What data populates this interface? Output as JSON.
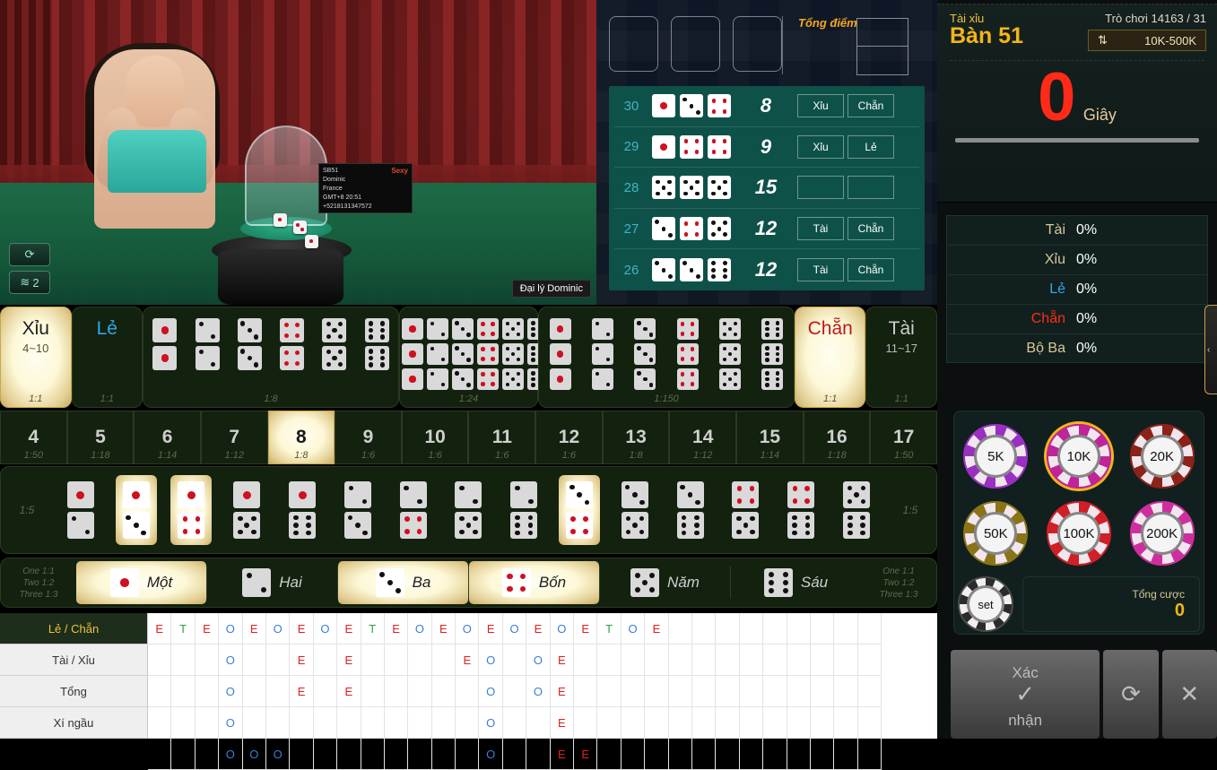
{
  "video": {
    "sign_lines": [
      "SB51",
      "Dominic",
      "France",
      "+5218131347572"
    ],
    "sign_meta": "GMT+8  20:51",
    "sign_logo": "Sexy",
    "dealer_tag": "Đại lý Dominic",
    "refresh_icon": "refresh-icon",
    "signal_icon": "wifi-icon",
    "signal_level": "2"
  },
  "history_panel": {
    "total_label": "Tổng điểm",
    "rows": [
      {
        "round": "30",
        "dice": [
          1,
          3,
          4
        ],
        "sum": "8",
        "tags": [
          "Xỉu",
          "Chẵn"
        ]
      },
      {
        "round": "29",
        "dice": [
          1,
          4,
          4
        ],
        "sum": "9",
        "tags": [
          "Xỉu",
          "Lẻ"
        ]
      },
      {
        "round": "28",
        "dice": [
          5,
          5,
          5
        ],
        "sum": "15",
        "tags": [
          "",
          ""
        ]
      },
      {
        "round": "27",
        "dice": [
          3,
          4,
          5
        ],
        "sum": "12",
        "tags": [
          "Tài",
          "Chẵn"
        ]
      },
      {
        "round": "26",
        "dice": [
          3,
          3,
          6
        ],
        "sum": "12",
        "tags": [
          "Tài",
          "Chẵn"
        ]
      }
    ]
  },
  "board": {
    "xiu": {
      "label": "Xỉu",
      "range": "4~10",
      "odds": "1:1",
      "selected": true
    },
    "le": {
      "label": "Lẻ",
      "odds": "1:1",
      "selected": false
    },
    "pairs": {
      "odds": "1:8",
      "values": [
        1,
        2,
        3,
        4,
        5,
        6
      ]
    },
    "triple_any": {
      "odds": "1:24",
      "values": [
        1,
        2,
        3,
        4,
        5,
        6
      ]
    },
    "triple_exact": {
      "odds": "1:150",
      "values": [
        1,
        2,
        3,
        4,
        5,
        6
      ]
    },
    "chan": {
      "label": "Chẵn",
      "odds": "1:1",
      "selected": true
    },
    "tai": {
      "label": "Tài",
      "range": "11~17",
      "odds": "1:1",
      "selected": false
    },
    "totals": [
      {
        "n": "4",
        "odds": "1:50",
        "selected": false
      },
      {
        "n": "5",
        "odds": "1:18",
        "selected": false
      },
      {
        "n": "6",
        "odds": "1:14",
        "selected": false
      },
      {
        "n": "7",
        "odds": "1:12",
        "selected": false
      },
      {
        "n": "8",
        "odds": "1:8",
        "selected": true
      },
      {
        "n": "9",
        "odds": "1:6",
        "selected": false
      },
      {
        "n": "10",
        "odds": "1:6",
        "selected": false
      },
      {
        "n": "11",
        "odds": "1:6",
        "selected": false
      },
      {
        "n": "12",
        "odds": "1:6",
        "selected": false
      },
      {
        "n": "13",
        "odds": "1:8",
        "selected": false
      },
      {
        "n": "14",
        "odds": "1:12",
        "selected": false
      },
      {
        "n": "15",
        "odds": "1:14",
        "selected": false
      },
      {
        "n": "16",
        "odds": "1:18",
        "selected": false
      },
      {
        "n": "17",
        "odds": "1:50",
        "selected": false
      }
    ],
    "combos": {
      "odds_left": "1:5",
      "odds_right": "1:5",
      "pairs": [
        {
          "a": 1,
          "b": 2,
          "selected": false
        },
        {
          "a": 1,
          "b": 3,
          "selected": true
        },
        {
          "a": 1,
          "b": 4,
          "selected": true
        },
        {
          "a": 1,
          "b": 5,
          "selected": false
        },
        {
          "a": 1,
          "b": 6,
          "selected": false
        },
        {
          "a": 2,
          "b": 3,
          "selected": false
        },
        {
          "a": 2,
          "b": 4,
          "selected": false
        },
        {
          "a": 2,
          "b": 5,
          "selected": false
        },
        {
          "a": 2,
          "b": 6,
          "selected": false
        },
        {
          "a": 3,
          "b": 4,
          "selected": true
        },
        {
          "a": 3,
          "b": 5,
          "selected": false
        },
        {
          "a": 3,
          "b": 6,
          "selected": false
        },
        {
          "a": 4,
          "b": 5,
          "selected": false
        },
        {
          "a": 4,
          "b": 6,
          "selected": false
        },
        {
          "a": 5,
          "b": 6,
          "selected": false
        }
      ]
    },
    "singles": {
      "odds_lines": [
        "One 1:1",
        "Two 1:2",
        "Three 1:3"
      ],
      "items": [
        {
          "face": 1,
          "label": "Một",
          "selected": true
        },
        {
          "face": 2,
          "label": "Hai",
          "selected": false
        },
        {
          "face": 3,
          "label": "Ba",
          "selected": true
        },
        {
          "face": 4,
          "label": "Bốn",
          "selected": true
        },
        {
          "face": 5,
          "label": "Năm",
          "selected": false
        },
        {
          "face": 6,
          "label": "Sáu",
          "selected": false
        }
      ]
    }
  },
  "roadmap": {
    "labels": [
      "Lẻ / Chẵn",
      "Tài / Xỉu",
      "Tổng",
      "Xí ngầu"
    ],
    "rows": [
      [
        "E",
        "T",
        "E",
        "O",
        "E",
        "O",
        "E",
        "O",
        "E",
        "T",
        "E",
        "O",
        "E",
        "O",
        "E",
        "O",
        "E",
        "O",
        "E",
        "T",
        "O",
        "E",
        "",
        "",
        "",
        "",
        "",
        "",
        "",
        "",
        ""
      ],
      [
        "",
        "",
        "",
        "O",
        "",
        "",
        "E",
        "",
        "E",
        "",
        "",
        "",
        "",
        "E",
        "O",
        "",
        "O",
        "E",
        "",
        "",
        "",
        "",
        "",
        "",
        "",
        "",
        "",
        "",
        "",
        "",
        ""
      ],
      [
        "",
        "",
        "",
        "O",
        "",
        "",
        "E",
        "",
        "E",
        "",
        "",
        "",
        "",
        "",
        "O",
        "",
        "O",
        "E",
        "",
        "",
        "",
        "",
        "",
        "",
        "",
        "",
        "",
        "",
        "",
        "",
        ""
      ],
      [
        "",
        "",
        "",
        "O",
        "",
        "",
        "",
        "",
        "",
        "",
        "",
        "",
        "",
        "",
        "O",
        "",
        "",
        "E",
        "",
        "",
        "",
        "",
        "",
        "",
        "",
        "",
        "",
        "",
        "",
        "",
        ""
      ],
      [
        "",
        "",
        "",
        "O",
        "O",
        "O",
        "",
        "",
        "",
        "",
        "",
        "",
        "",
        "",
        "O",
        "",
        "",
        "E",
        "E",
        "",
        "",
        "",
        "",
        "",
        "",
        "",
        "",
        "",
        "",
        "",
        ""
      ]
    ]
  },
  "right_panel": {
    "game_label": "Tài xỉu",
    "table_name": "Bàn 51",
    "round_label": "Trò chơi 14163 / 31",
    "limit_icon": "updown-arrows-icon",
    "limit": "10K-500K",
    "countdown": "0",
    "countdown_unit": "Giây",
    "stats": [
      {
        "name": "Tài",
        "value": "0%",
        "color_class": "c-gold"
      },
      {
        "name": "Xỉu",
        "value": "0%",
        "color_class": "c-gold"
      },
      {
        "name": "Lẻ",
        "value": "0%",
        "color_class": "c-blue"
      },
      {
        "name": "Chẵn",
        "value": "0%",
        "color_class": "c-red"
      },
      {
        "name": "Bộ Ba",
        "value": "0%",
        "color_class": "c-gold"
      }
    ],
    "chips": [
      {
        "label": "5K",
        "color": "#9b2fc4",
        "selected": false
      },
      {
        "label": "10K",
        "color": "#c0239a",
        "selected": true
      },
      {
        "label": "20K",
        "color": "#8c2218",
        "selected": false
      },
      {
        "label": "50K",
        "color": "#8a7418",
        "selected": false
      },
      {
        "label": "100K",
        "color": "#d11f28",
        "selected": false
      },
      {
        "label": "200K",
        "color": "#cf2f9e",
        "selected": false
      }
    ],
    "set_chip": {
      "label": "set",
      "color": "#2b2b2b"
    },
    "total_bet_label": "Tổng cược",
    "total_bet_value": "0",
    "actions": {
      "confirm_top": "Xác",
      "confirm_bottom": "nhận",
      "confirm_icon": "check-icon",
      "repeat_icon": "repeat-icon",
      "clear_icon": "close-icon"
    }
  }
}
